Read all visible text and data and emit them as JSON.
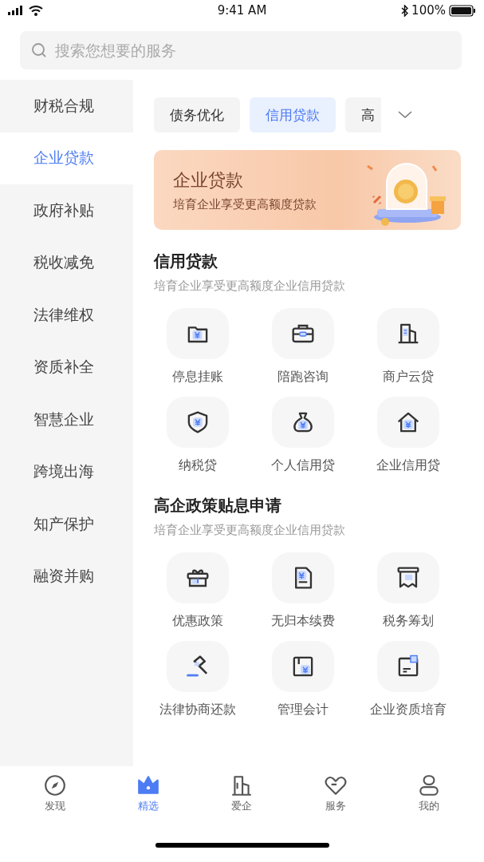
{
  "status_bar": {
    "time": "9:41 AM",
    "battery": "100%"
  },
  "search": {
    "placeholder": "搜索您想要的服务"
  },
  "sidebar": {
    "items": [
      {
        "label": "财税合规",
        "selected": false
      },
      {
        "label": "企业贷款",
        "selected": true
      },
      {
        "label": "政府补贴",
        "selected": false
      },
      {
        "label": "税收减免",
        "selected": false
      },
      {
        "label": "法律维权",
        "selected": false
      },
      {
        "label": "资质补全",
        "selected": false
      },
      {
        "label": "智慧企业",
        "selected": false
      },
      {
        "label": "跨境出海",
        "selected": false
      },
      {
        "label": "知产保护",
        "selected": false
      },
      {
        "label": "融资并购",
        "selected": false
      }
    ]
  },
  "tabs": [
    {
      "label": "债务优化",
      "selected": false
    },
    {
      "label": "信用贷款",
      "selected": true
    },
    {
      "label": "高",
      "selected": false
    }
  ],
  "banner": {
    "title": "企业贷款",
    "subtitle": "培育企业享受更高额度贷款"
  },
  "sections": [
    {
      "title": "信用贷款",
      "subtitle": "培育企业享受更高额度企业信用贷款",
      "items": [
        {
          "label": "停息挂账"
        },
        {
          "label": "陪跑咨询"
        },
        {
          "label": "商户云贷"
        },
        {
          "label": "纳税贷"
        },
        {
          "label": "个人信用贷"
        },
        {
          "label": "企业信用贷"
        }
      ]
    },
    {
      "title": "高企政策贴息申请",
      "subtitle": "培育企业享受更高额度企业信用贷款",
      "items": [
        {
          "label": "优惠政策"
        },
        {
          "label": "无归本续费"
        },
        {
          "label": "税务筹划"
        },
        {
          "label": "法律协商还款"
        },
        {
          "label": "管理会计"
        },
        {
          "label": "企业资质培育"
        }
      ]
    }
  ],
  "bottom_nav": [
    {
      "label": "发现",
      "selected": false
    },
    {
      "label": "精选",
      "selected": true
    },
    {
      "label": "爱企",
      "selected": false
    },
    {
      "label": "服务",
      "selected": false
    },
    {
      "label": "我的",
      "selected": false
    }
  ]
}
